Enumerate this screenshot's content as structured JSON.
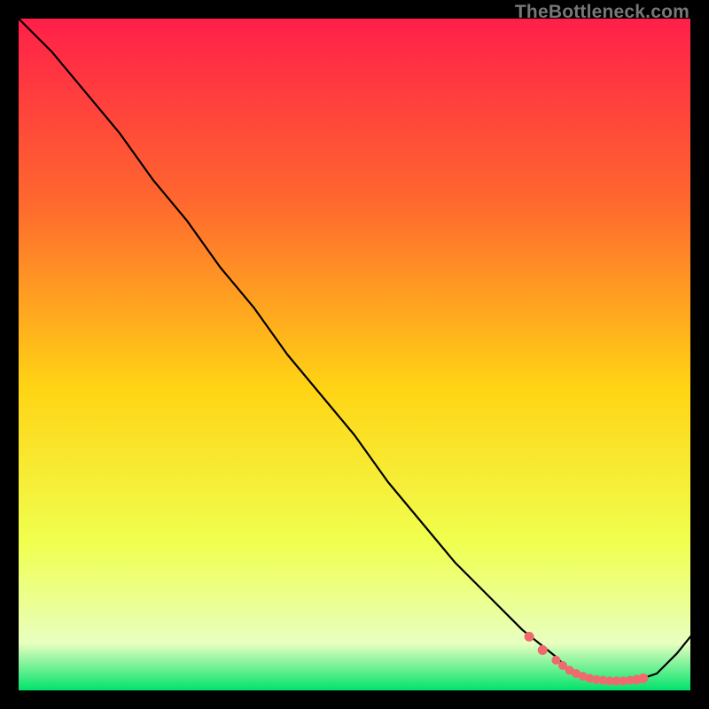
{
  "watermark": "TheBottleneck.com",
  "colors": {
    "top": "#ff1f49",
    "q1": "#ff6a2e",
    "mid": "#ffd414",
    "q3": "#f0ff4f",
    "pale": "#e8ffc0",
    "bottom": "#00e36b",
    "line": "#000000",
    "marker": "#ef6a6e",
    "bg": "#000000"
  },
  "chart_data": {
    "type": "line",
    "title": "",
    "xlabel": "",
    "ylabel": "",
    "xlim": [
      0,
      100
    ],
    "ylim": [
      0,
      100
    ],
    "series": [
      {
        "name": "curve",
        "x": [
          0,
          5,
          10,
          15,
          20,
          25,
          30,
          35,
          40,
          45,
          50,
          55,
          60,
          65,
          70,
          75,
          80,
          82,
          84,
          86,
          88,
          90,
          92,
          95,
          98,
          100
        ],
        "values": [
          100,
          95,
          89,
          83,
          76,
          70,
          63,
          57,
          50,
          44,
          38,
          31,
          25,
          19,
          14,
          9,
          5,
          3,
          2,
          1.5,
          1.2,
          1.2,
          1.5,
          2.5,
          5.5,
          8
        ]
      }
    ],
    "markers": {
      "name": "highlighted-points",
      "x": [
        76,
        78,
        80,
        81,
        82,
        83,
        84,
        85,
        86,
        87,
        88,
        89,
        90,
        91,
        92,
        93
      ],
      "values": [
        8,
        6,
        4.5,
        3.7,
        3,
        2.5,
        2.1,
        1.8,
        1.6,
        1.5,
        1.4,
        1.4,
        1.4,
        1.5,
        1.6,
        1.8
      ]
    }
  }
}
